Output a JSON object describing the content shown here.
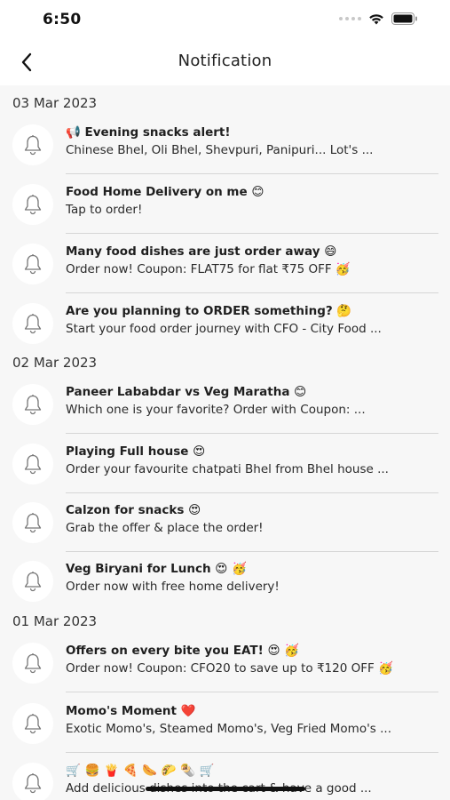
{
  "status_bar": {
    "time": "6:50"
  },
  "header": {
    "title": "Notification"
  },
  "sections": [
    {
      "date": "03 Mar 2023",
      "items": [
        {
          "title": "📢 Evening snacks alert!",
          "body": "Chinese Bhel, Oli Bhel, Shevpuri, Panipuri... Lot's ..."
        },
        {
          "title": "Food Home Delivery on me 😊",
          "body": "Tap to order!"
        },
        {
          "title": "Many food dishes are just order away 😄",
          "body": "Order now! Coupon: FLAT75 for flat ₹75 OFF 🥳"
        },
        {
          "title": "Are you planning to ORDER something? 🤔",
          "body": "Start your food order journey with CFO - City Food ..."
        }
      ]
    },
    {
      "date": "02 Mar 2023",
      "items": [
        {
          "title": "Paneer Lababdar vs Veg Maratha 😊",
          "body": "Which one is your favorite? Order with Coupon: ..."
        },
        {
          "title": "Playing Full house 😍",
          "body": "Order your favourite chatpati Bhel from Bhel house ..."
        },
        {
          "title": "Calzon for snacks 😍",
          "body": "Grab the offer & place the order!"
        },
        {
          "title": "Veg Biryani for Lunch 😍 🥳",
          "body": "Order now with free home delivery!"
        }
      ]
    },
    {
      "date": "01 Mar 2023",
      "items": [
        {
          "title": "Offers on every bite you EAT! 😍 🥳",
          "body": "Order now! Coupon: CFO20 to save up to ₹120 OFF 🥳"
        },
        {
          "title": "Momo's Moment ❤️",
          "body": "Exotic Momo's, Steamed Momo's, Veg Fried Momo's ..."
        },
        {
          "title": "🛒 🍔 🍟 🍕 🌭 🌮 🌯 🛒",
          "body": "Add delicious dishes into the cart & have a good ..."
        }
      ]
    }
  ]
}
